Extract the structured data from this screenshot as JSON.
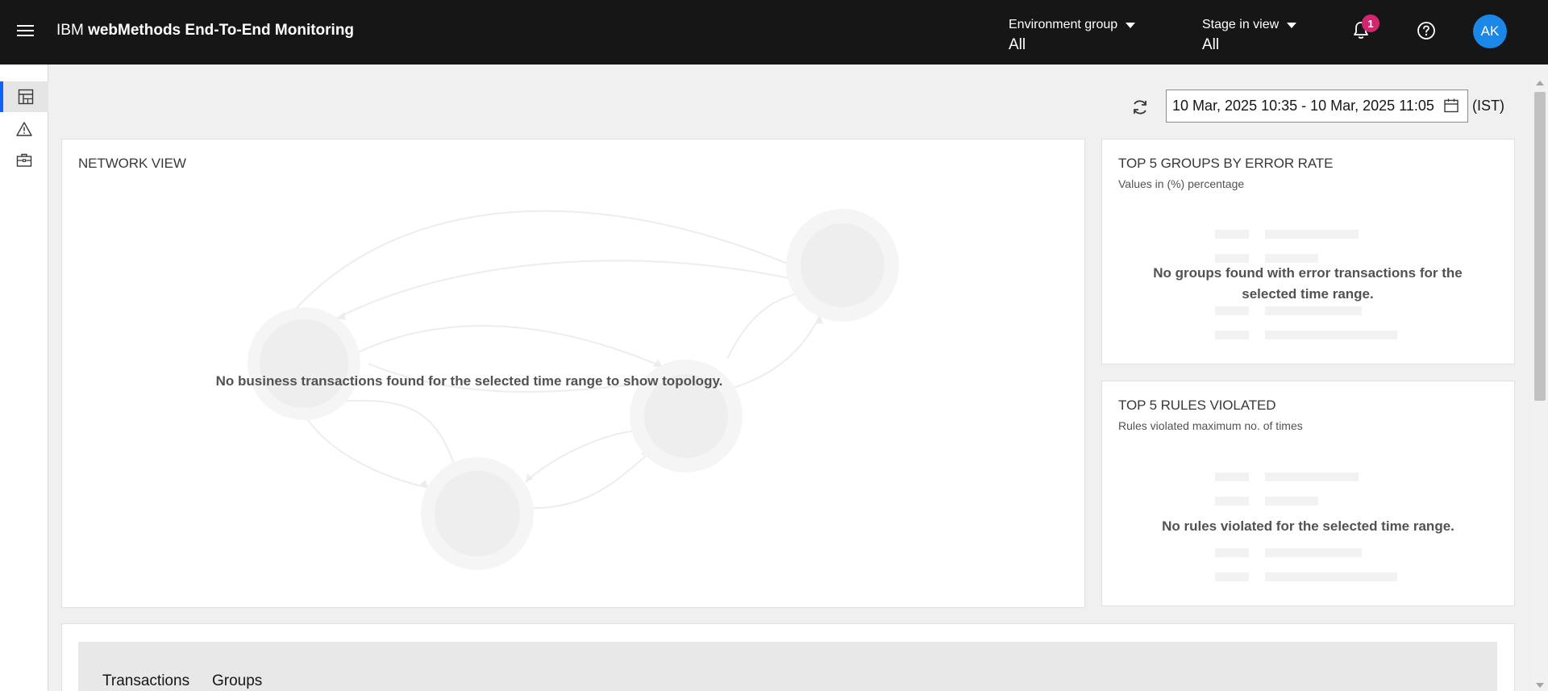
{
  "header": {
    "title_prefix": "IBM",
    "title_name": "webMethods End-To-End Monitoring",
    "environment_group": {
      "label": "Environment group",
      "value": "All"
    },
    "stage_in_view": {
      "label": "Stage in view",
      "value": "All"
    },
    "notifications_count": "1",
    "avatar_initials": "AK"
  },
  "rail": {
    "items": [
      {
        "icon": "dashboard-icon",
        "active": true
      },
      {
        "icon": "warning-icon",
        "active": false
      },
      {
        "icon": "briefcase-icon",
        "active": false
      }
    ]
  },
  "toolbar": {
    "date_range": "10 Mar, 2025 10:35 - 10 Mar, 2025 11:05",
    "timezone": "(IST)"
  },
  "network_view": {
    "title": "NETWORK VIEW",
    "empty_message": "No business transactions found for the selected time range to show topology."
  },
  "top_errors": {
    "title": "TOP 5 GROUPS BY ERROR RATE",
    "subtitle": "Values in (%) percentage",
    "empty_message": "No groups found with error transactions for the selected time range."
  },
  "top_rules": {
    "title": "TOP 5 RULES VIOLATED",
    "subtitle": "Rules violated maximum no. of times",
    "empty_message": "No rules violated for the selected time range."
  },
  "bottom_tabs": [
    "Transactions",
    "Groups"
  ],
  "colors": {
    "header_bg": "#161616",
    "accent": "#0f62fe",
    "badge": "#d12771",
    "avatar": "#1b87e6"
  }
}
